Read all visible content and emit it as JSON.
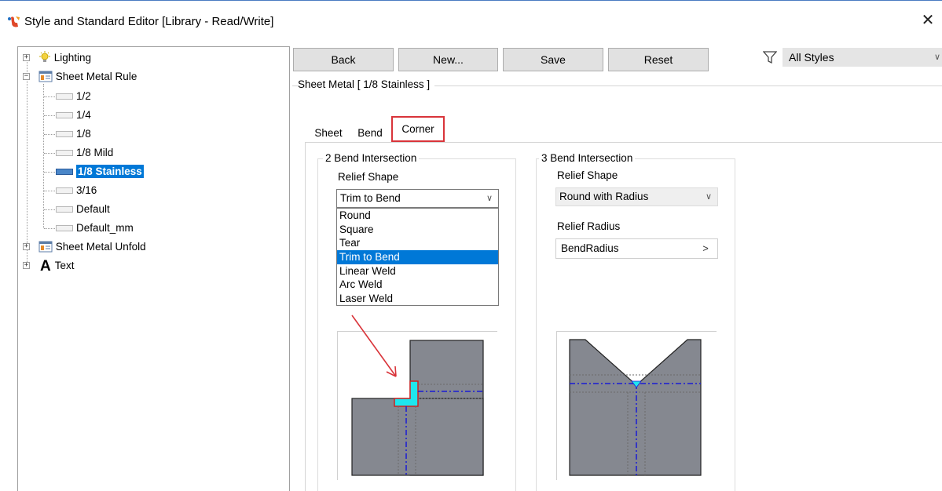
{
  "window": {
    "title": "Style and Standard Editor [Library - Read/Write]",
    "close_glyph": "✕"
  },
  "tree": {
    "expander_plus": "+",
    "expander_minus": "−",
    "lighting": "Lighting",
    "sheet_metal_rule": "Sheet Metal Rule",
    "children": [
      "1/2",
      "1/4",
      "1/8",
      "1/8 Mild",
      "1/8 Stainless",
      "3/16",
      "Default",
      "Default_mm"
    ],
    "selected": "1/8 Stainless",
    "sheet_metal_unfold": "Sheet Metal Unfold",
    "text": "Text",
    "text_icon_glyph": "A"
  },
  "toolbar": {
    "back": "Back",
    "new": "New...",
    "save": "Save",
    "reset": "Reset",
    "filter_value": "All Styles",
    "chevron": "∨"
  },
  "style_header": "Sheet Metal [ 1/8 Stainless ]",
  "tabs": {
    "sheet": "Sheet",
    "bend": "Bend",
    "corner": "Corner",
    "active": "Corner"
  },
  "two_bend": {
    "legend": "2 Bend Intersection",
    "relief_shape_label": "Relief Shape",
    "relief_shape_value": "Trim to Bend",
    "options": [
      "Round",
      "Square",
      "Tear",
      "Trim to Bend",
      "Linear Weld",
      "Arc Weld",
      "Laser Weld"
    ],
    "selected_option": "Trim to Bend"
  },
  "three_bend": {
    "legend": "3 Bend Intersection",
    "relief_shape_label": "Relief Shape",
    "relief_shape_value": "Round with Radius",
    "relief_radius_label": "Relief Radius",
    "relief_radius_value": "BendRadius",
    "relief_radius_button": ">"
  },
  "colors": {
    "selection": "#0078d7",
    "highlight_border": "#d9343a",
    "plate_fill": "#858890",
    "relief_fill": "#1ee6ee",
    "centerline": "#1a1ad6"
  }
}
